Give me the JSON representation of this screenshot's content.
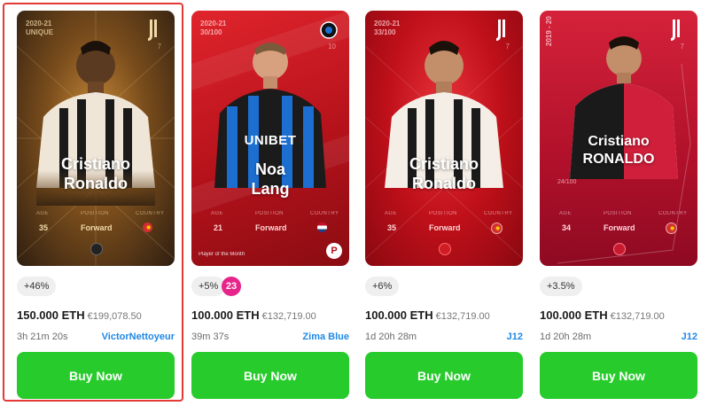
{
  "listings": [
    {
      "season": "2020-21",
      "scarcity": "UNIQUE",
      "jersey_number": "7",
      "name_line1": "Cristiano",
      "name_line2": "Ronaldo",
      "age_label": "AGE",
      "age": "35",
      "position_label": "POSITION",
      "position": "Forward",
      "country_label": "COUNTRY",
      "change": "+46%",
      "price_eth": "150.000 ETH",
      "price_eur": "€199,078.50",
      "time_left": "3h 21m 20s",
      "seller": "VictorNettoyeur",
      "buy_label": "Buy Now"
    },
    {
      "season": "2020-21",
      "scarcity": "30/100",
      "jersey_number": "10",
      "name_line1": "Noa",
      "name_line2": "Lang",
      "age_label": "AGE",
      "age": "21",
      "position_label": "POSITION",
      "position": "Forward",
      "country_label": "COUNTRY",
      "sponsor": "UNIBET",
      "card_note": "Player of the Month",
      "change": "+5%",
      "extra_badge": "23",
      "price_eth": "100.000 ETH",
      "price_eur": "€132,719.00",
      "time_left": "39m 37s",
      "seller": "Zima Blue",
      "buy_label": "Buy Now"
    },
    {
      "season": "2020-21",
      "scarcity": "33/100",
      "jersey_number": "7",
      "name_line1": "Cristiano",
      "name_line2": "Ronaldo",
      "age_label": "AGE",
      "age": "35",
      "position_label": "POSITION",
      "position": "Forward",
      "country_label": "COUNTRY",
      "change": "+6%",
      "price_eth": "100.000 ETH",
      "price_eur": "€132,719.00",
      "time_left": "1d 20h 28m",
      "seller": "J12",
      "buy_label": "Buy Now"
    },
    {
      "season": "2019 - 20",
      "serial": "24/100",
      "jersey_number": "7",
      "name_line1": "Cristiano",
      "name_line2": "RONALDO",
      "age_label": "AGE",
      "age": "34",
      "position_label": "POSITION",
      "position": "Forward",
      "country_label": "COUNTRY",
      "change": "+3.5%",
      "price_eth": "100.000 ETH",
      "price_eur": "€132,719.00",
      "time_left": "1d 20h 28m",
      "seller": "J12",
      "buy_label": "Buy Now"
    }
  ],
  "colors": {
    "buy_button": "#27cc2c",
    "seller_link": "#1e88e5",
    "selected_outline": "#e53935",
    "unique_card": "#3d2a14",
    "rare_card": "#c8101a",
    "badge": "#e6248a"
  }
}
